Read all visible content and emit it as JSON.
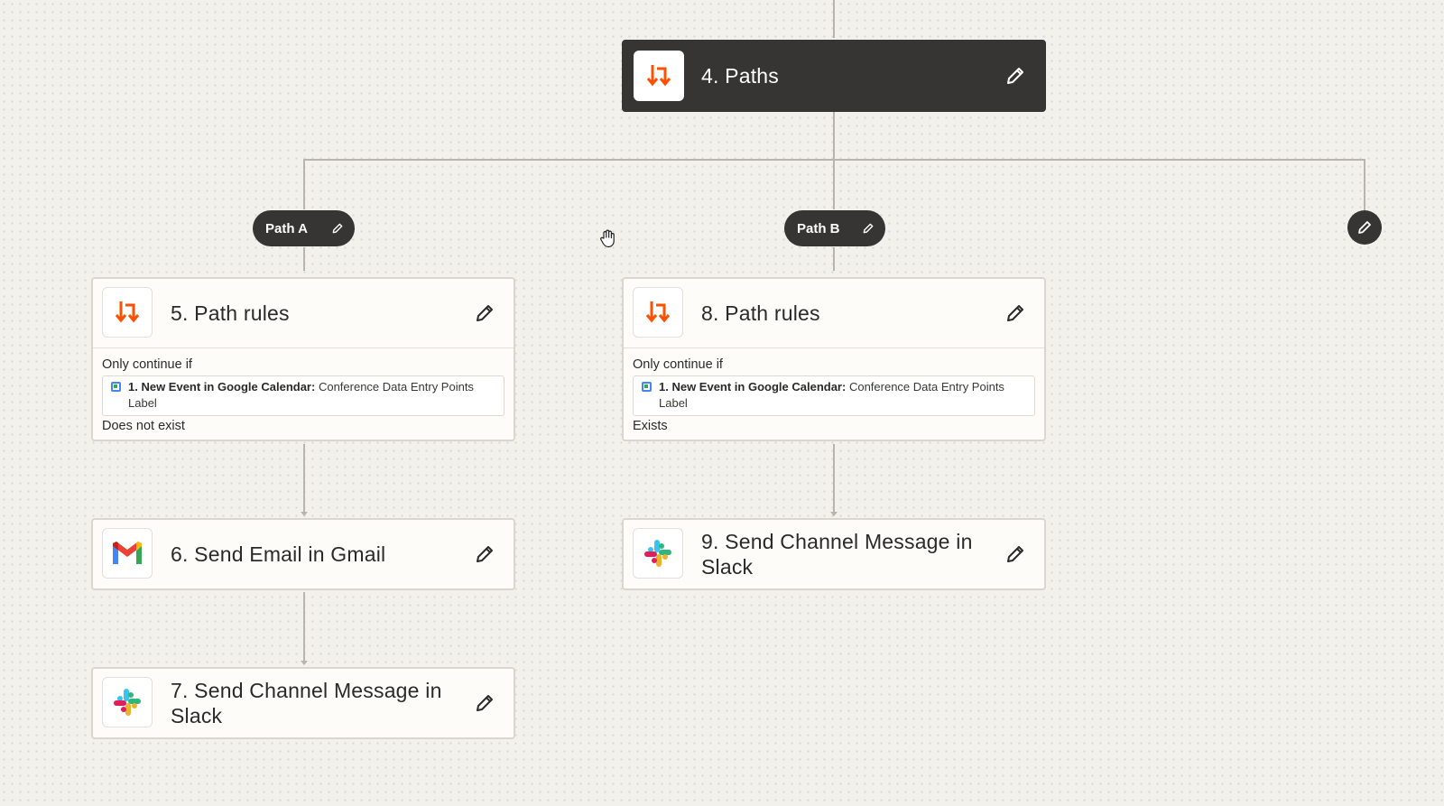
{
  "paths_step": {
    "title": "4. Paths",
    "icon": "paths-icon"
  },
  "path_a": {
    "label": "Path A",
    "rules": {
      "title": "5. Path rules",
      "intro": "Only continue if",
      "field_app": "1. New Event in Google Calendar:",
      "field_name": "Conference Data Entry Points",
      "field_sub": "Label",
      "operator": "Does not exist"
    },
    "action1": {
      "title": "6. Send Email in Gmail",
      "icon": "gmail-icon"
    },
    "action2": {
      "title": "7. Send Channel Message in Slack",
      "icon": "slack-icon"
    }
  },
  "path_b": {
    "label": "Path B",
    "rules": {
      "title": "8. Path rules",
      "intro": "Only continue if",
      "field_app": "1. New Event in Google Calendar:",
      "field_name": "Conference Data Entry Points",
      "field_sub": "Label",
      "operator": "Exists"
    },
    "action1": {
      "title": "9. Send Channel Message in Slack",
      "icon": "slack-icon"
    }
  },
  "colors": {
    "canvas": "#f3f1ec",
    "dark_node": "#363533",
    "paths_orange": "#ff4f00",
    "connector": "#b8b5ae"
  }
}
